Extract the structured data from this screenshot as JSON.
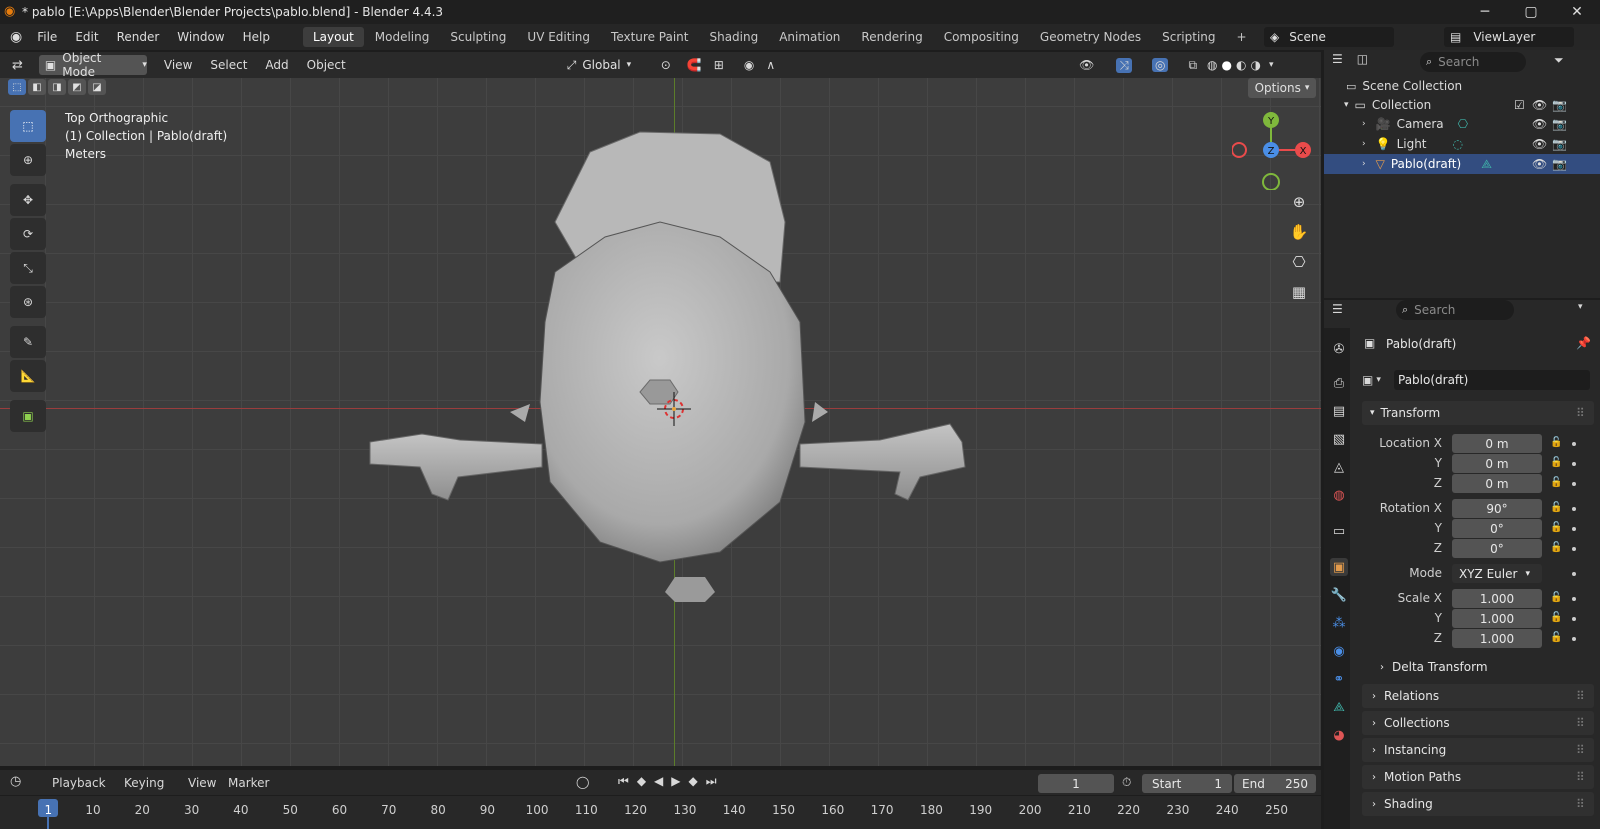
{
  "window": {
    "title": "* pablo [E:\\Apps\\Blender\\Blender Projects\\pablo.blend] - Blender 4.4.3"
  },
  "menu": [
    "File",
    "Edit",
    "Render",
    "Window",
    "Help"
  ],
  "workspaces": [
    "Layout",
    "Modeling",
    "Sculpting",
    "UV Editing",
    "Texture Paint",
    "Shading",
    "Animation",
    "Rendering",
    "Compositing",
    "Geometry Nodes",
    "Scripting"
  ],
  "scene": {
    "label": "Scene",
    "view_layer": "ViewLayer"
  },
  "viewport_header": {
    "mode": "Object Mode",
    "menus": [
      "View",
      "Select",
      "Add",
      "Object"
    ],
    "orientation": "Global",
    "options": "Options"
  },
  "overlay": {
    "view": "Top Orthographic",
    "collection": "(1) Collection | Pablo(draft)",
    "units": "Meters"
  },
  "gizmo": {
    "x": "X",
    "y": "Y",
    "z": "Z"
  },
  "outliner": {
    "search_placeholder": "Search",
    "scene_collection": "Scene Collection",
    "collection": "Collection",
    "items": [
      "Camera",
      "Light",
      "Pablo(draft)"
    ]
  },
  "properties": {
    "search_placeholder": "Search",
    "object_name": "Pablo(draft)",
    "data_name": "Pablo(draft)",
    "transform_label": "Transform",
    "location": {
      "label": "Location X",
      "x": "0 m",
      "y": "0 m",
      "z": "0 m"
    },
    "rotation": {
      "label": "Rotation X",
      "x": "90°",
      "y": "0°",
      "z": "0°"
    },
    "mode": {
      "label": "Mode",
      "value": "XYZ Euler"
    },
    "scale": {
      "label": "Scale X",
      "x": "1.000",
      "y": "1.000",
      "z": "1.000"
    },
    "axis_y": "Y",
    "axis_z": "Z",
    "delta": "Delta Transform",
    "sections": [
      "Relations",
      "Collections",
      "Instancing",
      "Motion Paths",
      "Shading"
    ]
  },
  "timeline": {
    "menus": [
      "Playback",
      "Keying",
      "View",
      "Marker"
    ],
    "current_frame": "1",
    "start_label": "Start",
    "start": "1",
    "end_label": "End",
    "end": "250",
    "ticks": [
      "1",
      "10",
      "20",
      "30",
      "40",
      "50",
      "60",
      "70",
      "80",
      "90",
      "100",
      "110",
      "120",
      "130",
      "140",
      "150",
      "160",
      "170",
      "180",
      "190",
      "200",
      "210",
      "220",
      "230",
      "240",
      "250"
    ]
  },
  "colors": {
    "accent": "#4772b3",
    "x_axis": "#e94b4b",
    "y_axis": "#7fb83c",
    "z_axis": "#4a8ee6",
    "selected_row": "#334d80"
  }
}
